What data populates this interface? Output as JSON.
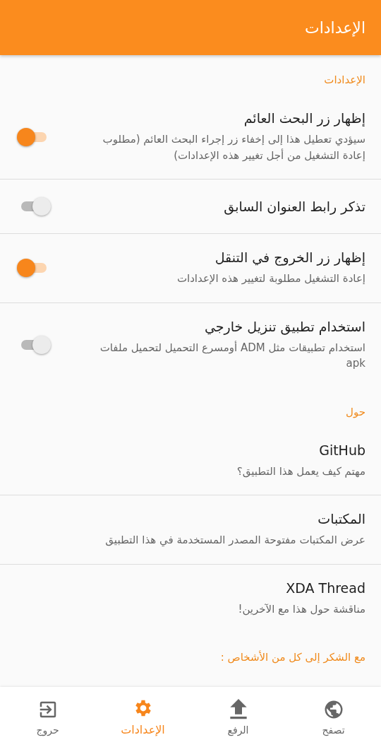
{
  "app_bar": {
    "title": "الإعدادات"
  },
  "sections": [
    {
      "header": "الإعدادات",
      "items": [
        {
          "kind": "switch",
          "title": "إظهار زر البحث العائم",
          "summary": "سيؤدي تعطيل هذا إلى إخفاء زر إجراء البحث العائم (مطلوب إعادة التشغيل من أجل تغيير هذه الإعدادات)",
          "on": true
        },
        {
          "kind": "switch",
          "title": "تذكر رابط العنوان السابق",
          "on": false
        },
        {
          "kind": "switch",
          "title": "إظهار زر الخروج في التنقل",
          "summary": "إعادة التشغيل مطلوبة لتغيير هذه الإعدادات",
          "on": true
        },
        {
          "kind": "switch",
          "title": "استخدام تطبيق تنزيل خارجي",
          "summary": "استخدام تطبيقات مثل ADM أومسرع التحميل لتحميل ملفات apk",
          "on": false
        }
      ]
    },
    {
      "header": "حول",
      "items": [
        {
          "kind": "link",
          "title": "GitHub",
          "summary": "مهتم كيف يعمل هذا التطبيق؟"
        },
        {
          "kind": "link",
          "title": "المكتبات",
          "summary": "عرض المكتبات مفتوحة المصدر المستخدمة في هذا التطبيق"
        },
        {
          "kind": "link",
          "title": "XDA Thread",
          "summary": "مناقشة حول هذا مع الآخرين!"
        }
      ]
    },
    {
      "header": "مع الشكر إلى كل من الأشخاص :"
    }
  ],
  "bottom_nav": [
    {
      "kind": "globe",
      "label": "تصفح",
      "selected": false
    },
    {
      "kind": "upload",
      "label": "الرفع",
      "selected": false
    },
    {
      "kind": "settings",
      "label": "الإعدادات",
      "selected": true
    },
    {
      "kind": "exit",
      "label": "حروج",
      "selected": false
    }
  ]
}
